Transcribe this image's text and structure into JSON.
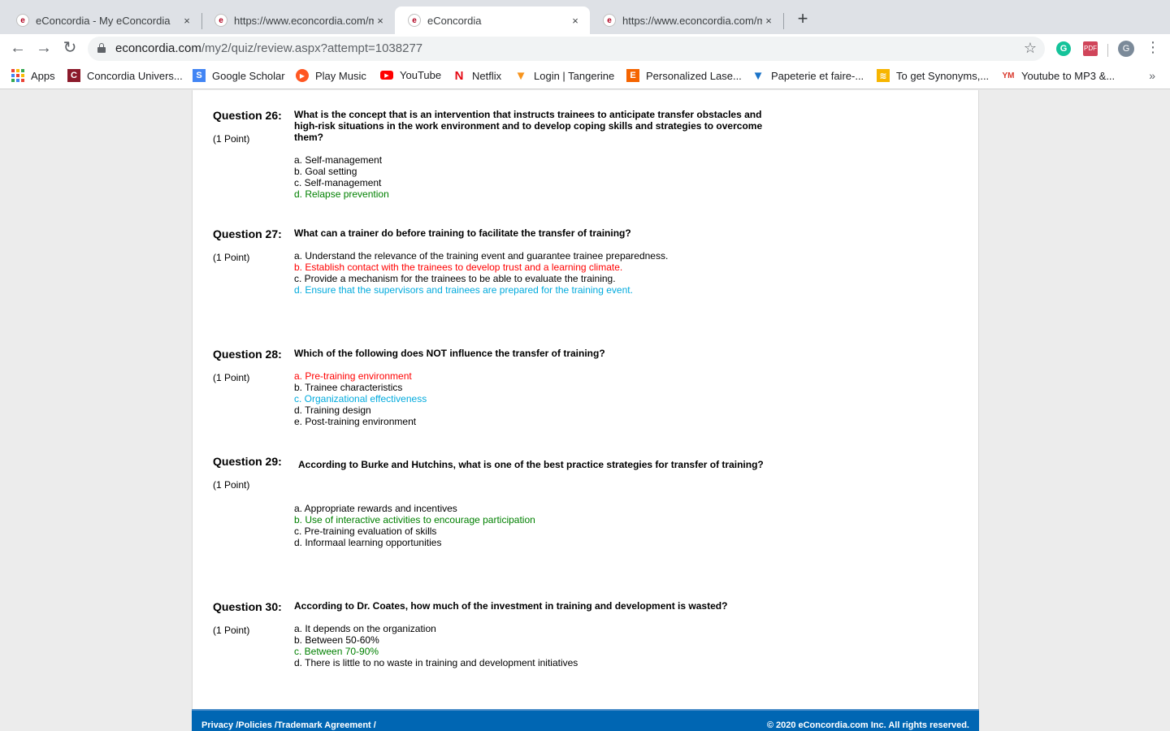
{
  "browser": {
    "tabs": [
      {
        "title": "eConcordia - My eConcordia",
        "active": false
      },
      {
        "title": "https://www.econcordia.com/m",
        "active": false
      },
      {
        "title": "eConcordia",
        "active": true
      },
      {
        "title": "https://www.econcordia.com/m",
        "active": false
      }
    ],
    "close_glyph": "×",
    "new_tab_glyph": "+",
    "url_host": "econcordia.com",
    "url_path": "/my2/quiz/review.aspx?attempt=1038277",
    "profile_initial": "G",
    "bookmarks": [
      "Apps",
      "Concordia Univers...",
      "Google Scholar",
      "Play Music",
      "YouTube",
      "Netflix",
      "Login | Tangerine",
      "Personalized Lase...",
      "Papeterie et faire-...",
      "To get Synonyms,...",
      "Youtube to MP3 &..."
    ],
    "more_bookmarks": "»"
  },
  "quiz": {
    "questions": [
      {
        "label": "Question 26:",
        "points": "(1 Point)",
        "text": "What is the concept that is an intervention that instructs trainees to anticipate transfer obstacles and high-risk situations in the work environment and to develop coping skills and strategies to overcome them?",
        "options": [
          {
            "text": "a. Self-management",
            "color": "#000000"
          },
          {
            "text": "b. Goal setting",
            "color": "#000000"
          },
          {
            "text": "c. Self-management",
            "color": "#000000"
          },
          {
            "text": "d. Relapse prevention",
            "color": "#008000"
          }
        ]
      },
      {
        "label": "Question 27:",
        "points": "(1 Point)",
        "text": "What can a trainer do before training to facilitate the transfer of training?",
        "options": [
          {
            "text": "a. Understand the relevance of the training event and guarantee trainee preparedness.",
            "color": "#000000"
          },
          {
            "text": "b. Establish contact with the trainees to develop trust and a learning climate.",
            "color": "#ff0000"
          },
          {
            "text": "c. Provide a mechanism for the trainees to be able to evaluate the training.",
            "color": "#000000"
          },
          {
            "text": "d. Ensure that the supervisors and trainees are prepared for the training event.",
            "color": "#00aadd"
          }
        ]
      },
      {
        "label": "Question 28:",
        "points": "(1 Point)",
        "text": "Which of the following does NOT influence the transfer of training?",
        "options": [
          {
            "text": "a. Pre-training environment",
            "color": "#ff0000"
          },
          {
            "text": "b. Trainee characteristics",
            "color": "#000000"
          },
          {
            "text": "c. Organizational effectiveness",
            "color": "#00aadd"
          },
          {
            "text": "d. Training design",
            "color": "#000000"
          },
          {
            "text": "e. Post-training environment",
            "color": "#000000"
          }
        ]
      },
      {
        "label": "Question 29:",
        "points": "(1 Point)",
        "text": "According to Burke and Hutchins, what is one of the best practice strategies for transfer of training?",
        "options": [
          {
            "text": "a. Appropriate rewards and incentives",
            "color": "#000000"
          },
          {
            "text": "b. Use of interactive activities to encourage participation",
            "color": "#008000"
          },
          {
            "text": "c. Pre-training evaluation of skills",
            "color": "#000000"
          },
          {
            "text": "d. Informaal learning opportunities",
            "color": "#000000"
          }
        ]
      },
      {
        "label": "Question 30:",
        "points": "(1 Point)",
        "text": "According to Dr. Coates, how much of the investment in training and development is wasted?",
        "options": [
          {
            "text": "a. It depends on the organization",
            "color": "#000000"
          },
          {
            "text": "b. Between 50-60%",
            "color": "#000000"
          },
          {
            "text": "c. Between 70-90%",
            "color": "#008000"
          },
          {
            "text": "d. There is little to no waste in training and development initiatives",
            "color": "#000000"
          }
        ]
      }
    ]
  },
  "footer": {
    "links": "Privacy  /Policies  /Trademark Agreement  /",
    "copyright": "© 2020 eConcordia.com Inc. All rights reserved."
  },
  "colors": {
    "correct": "#008000",
    "incorrect": "#ff0000",
    "selected": "#00aadd",
    "footer_bg": "#0066b3"
  }
}
